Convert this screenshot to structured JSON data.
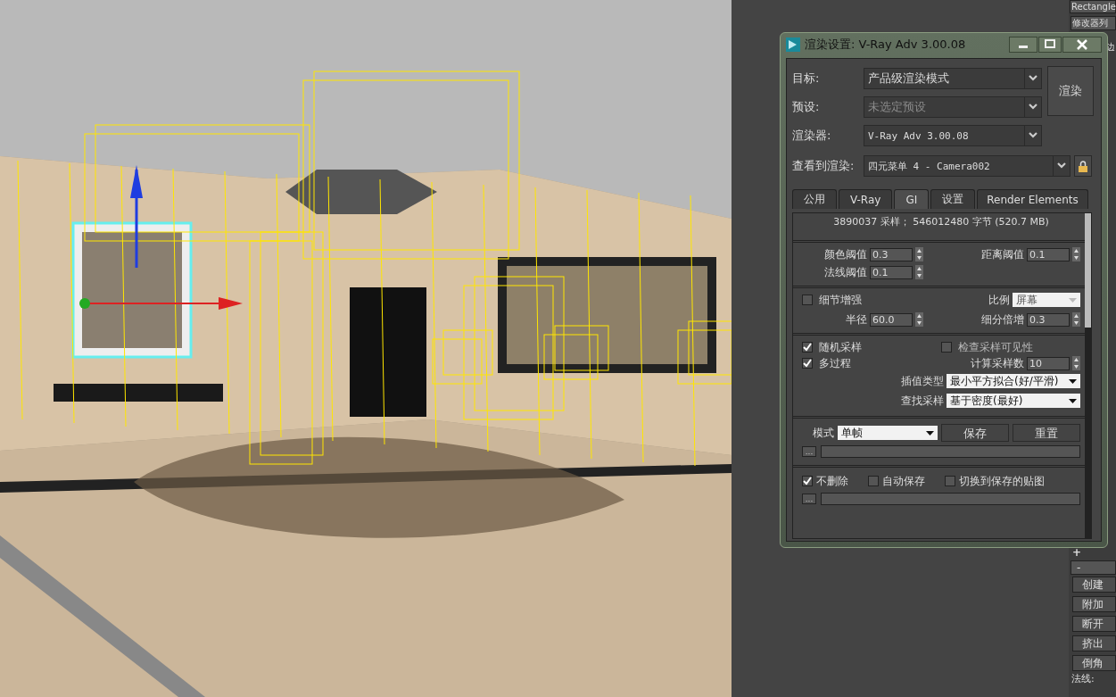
{
  "command_panel": {
    "object_name": "Rectangle",
    "modifier_list": "修改器列",
    "labels": [
      "边"
    ],
    "rollout_add": "+",
    "rollout_header": "-",
    "buttons": [
      "创建",
      "附加",
      "断开",
      "挤出",
      "倒角"
    ],
    "footer_label": "法线:"
  },
  "dialog": {
    "title": "渲染设置: V-Ray Adv 3.00.08",
    "fields": [
      {
        "label": "目标:",
        "value": "产品级渲染模式",
        "disabled": false
      },
      {
        "label": "预设:",
        "value": "未选定预设",
        "disabled": true
      },
      {
        "label": "渲染器:",
        "value": "V-Ray Adv 3.00.08",
        "disabled": false
      }
    ],
    "render_button": "渲染",
    "view_field": {
      "label": "查看到渲染:",
      "value": "四元菜单 4 - Camera002"
    },
    "tabs": [
      {
        "label": "公用",
        "selected": false
      },
      {
        "label": "V-Ray",
        "selected": false
      },
      {
        "label": "GI",
        "selected": true
      },
      {
        "label": "设置",
        "selected": false
      },
      {
        "label": "Render Elements",
        "selected": false
      }
    ],
    "stats": "3890037 采样； 546012480 字节 (520.7 MB)",
    "thresholds": [
      {
        "label": "颜色阈值",
        "value": "0.3"
      },
      {
        "label": "距离阈值",
        "value": "0.1"
      },
      {
        "label": "法线阈值",
        "value": "0.1"
      }
    ],
    "detail": {
      "label": "细节增强",
      "checked": false,
      "scale_label": "比例",
      "scale_value": "屏幕",
      "radius_label": "半径",
      "radius_value": "60.0",
      "subdiv_label": "细分倍增",
      "subdiv_value": "0.3"
    },
    "options": [
      {
        "label": "随机采样",
        "checked": true
      },
      {
        "label": "检查采样可见性",
        "checked": false
      },
      {
        "label": "多过程",
        "checked": true
      }
    ],
    "calc_samples": {
      "label": "计算采样数",
      "value": "10"
    },
    "dropdowns": [
      {
        "label": "插值类型",
        "value": "最小平方拟合(好/平滑)"
      },
      {
        "label": "查找采样",
        "value": "基于密度(最好)"
      }
    ],
    "mode": {
      "label": "模式",
      "value": "单帧",
      "buttons": [
        "保存",
        "重置"
      ],
      "browse": "..."
    },
    "after": [
      {
        "label": "不删除",
        "checked": true
      },
      {
        "label": "自动保存",
        "checked": false
      },
      {
        "label": "切换到保存的贴图",
        "checked": false
      }
    ],
    "after_browse": "..."
  }
}
